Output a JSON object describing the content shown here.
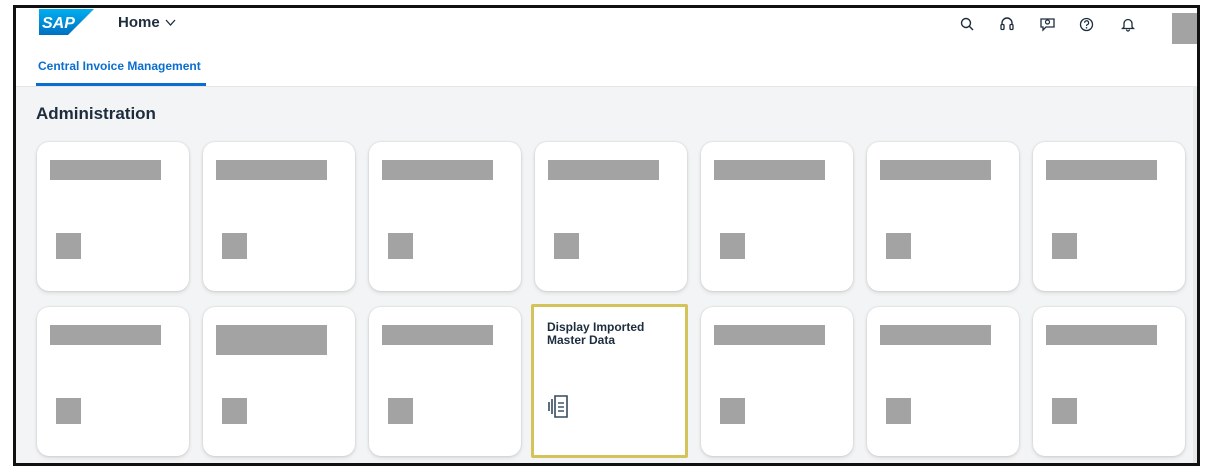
{
  "header": {
    "logo_text": "SAP",
    "home_label": "Home",
    "icons": [
      "search-icon",
      "headset-icon",
      "chat-icon",
      "help-icon",
      "bell-icon"
    ]
  },
  "tabs": [
    {
      "label": "Central Invoice Management",
      "active": true
    }
  ],
  "section": {
    "title": "Administration"
  },
  "tiles": [
    {
      "title": "Display Imported Master Data",
      "icon": "document-stack-icon",
      "highlighted": true
    }
  ],
  "colors": {
    "accent": "#0a6ed1",
    "highlight_border": "#d4c35a",
    "redacted": "#a3a3a3",
    "background": "#f3f4f5"
  }
}
